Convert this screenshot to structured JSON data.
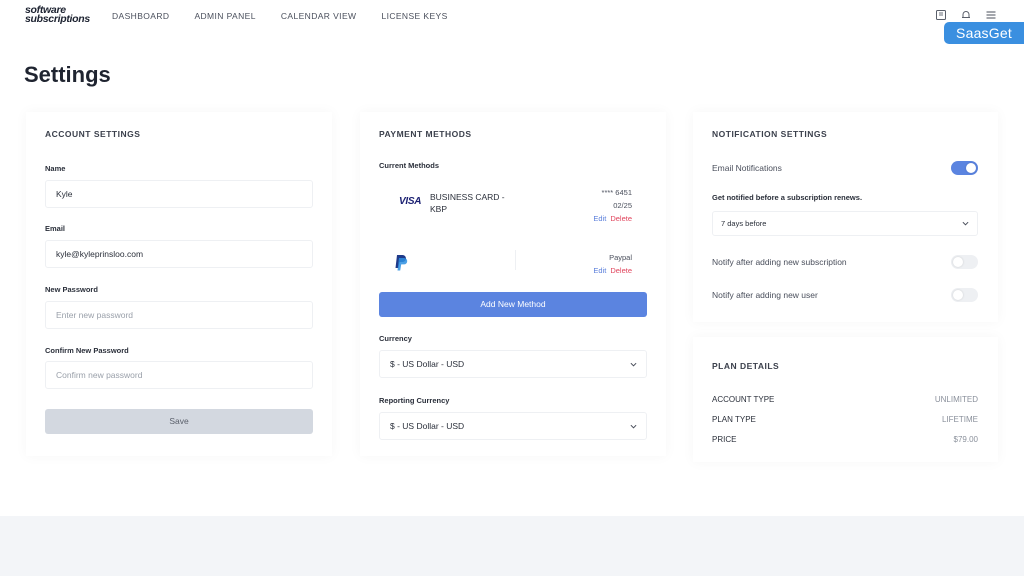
{
  "header": {
    "logo_line1": "software",
    "logo_line2": "subscriptions",
    "nav": [
      "DASHBOARD",
      "ADMIN PANEL",
      "CALENDAR VIEW",
      "LICENSE KEYS"
    ],
    "icons": [
      "book-icon",
      "bell-icon",
      "menu-icon"
    ],
    "badge": "SaasGet"
  },
  "page": {
    "title": "Settings"
  },
  "account": {
    "title": "ACCOUNT SETTINGS",
    "name_label": "Name",
    "name_value": "Kyle",
    "email_label": "Email",
    "email_value": "kyle@kyleprinsloo.com",
    "new_password_label": "New Password",
    "new_password_placeholder": "Enter new password",
    "confirm_password_label": "Confirm New Password",
    "confirm_password_placeholder": "Confirm new password",
    "save_label": "Save"
  },
  "payment": {
    "title": "PAYMENT METHODS",
    "current_label": "Current Methods",
    "methods": [
      {
        "brand": "VISA",
        "name": "BUSINESS CARD - KBP",
        "number": "**** 6451",
        "expiry": "02/25",
        "edit": "Edit",
        "delete": "Delete"
      },
      {
        "brand": "paypal-icon",
        "name": "",
        "number": "Paypal",
        "expiry": "",
        "edit": "Edit",
        "delete": "Delete"
      }
    ],
    "add_label": "Add New Method",
    "currency_label": "Currency",
    "currency_value": "$ - US Dollar - USD",
    "reporting_label": "Reporting Currency",
    "reporting_value": "$ - US Dollar - USD"
  },
  "notifications": {
    "title": "NOTIFICATION SETTINGS",
    "email_label": "Email Notifications",
    "renew_label": "Get notified before a subscription renews.",
    "renew_value": "7 days before",
    "after_sub_label": "Notify after adding new subscription",
    "after_user_label": "Notify after adding new user",
    "email_on": true,
    "after_sub_on": false,
    "after_user_on": false
  },
  "plan": {
    "title": "PLAN DETAILS",
    "rows": [
      {
        "key": "ACCOUNT TYPE",
        "value": "UNLIMITED"
      },
      {
        "key": "PLAN TYPE",
        "value": "LIFETIME"
      },
      {
        "key": "PRICE",
        "value": "$79.00"
      }
    ]
  },
  "colors": {
    "accent": "#5b84e0",
    "danger": "#e0445c",
    "badge": "#3a8fe0"
  }
}
